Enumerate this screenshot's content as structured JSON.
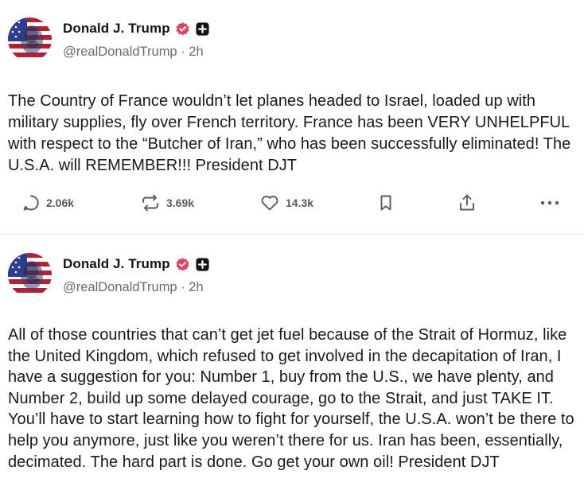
{
  "accent": "#e4405f",
  "posts": [
    {
      "author": "Donald J. Trump",
      "handle": "@realDonaldTrump",
      "time": "· 2h",
      "verified_icon": "verified-badge-icon",
      "extra_icon": "plus-square-icon",
      "body": "The Country of France wouldn’t let planes headed to Israel, loaded up with military supplies, fly over French territory. France has been VERY UNHELPFUL with respect to the “Butcher of Iran,” who has been successfully eliminated! The U.S.A. will REMEMBER!!! President DJT",
      "replies": "2.06k",
      "retruths": "3.69k",
      "likes": "14.3k"
    },
    {
      "author": "Donald J. Trump",
      "handle": "@realDonaldTrump",
      "time": "· 2h",
      "verified_icon": "verified-badge-icon",
      "extra_icon": "plus-square-icon",
      "body": "All of those countries that can’t get jet fuel because of the Strait of Hormuz, like the United Kingdom, which refused to get involved in the decapitation of Iran, I have a suggestion for you: Number 1, buy from the U.S., we have plenty, and Number 2, build up some delayed courage, go to the Strait, and just TAKE IT. You’ll have to start learning how to fight for yourself, the U.S.A. won’t be there to help you anymore, just like you weren’t there for us. Iran has been, essentially, decimated. The hard part is done. Go get your own oil! President DJT"
    }
  ]
}
